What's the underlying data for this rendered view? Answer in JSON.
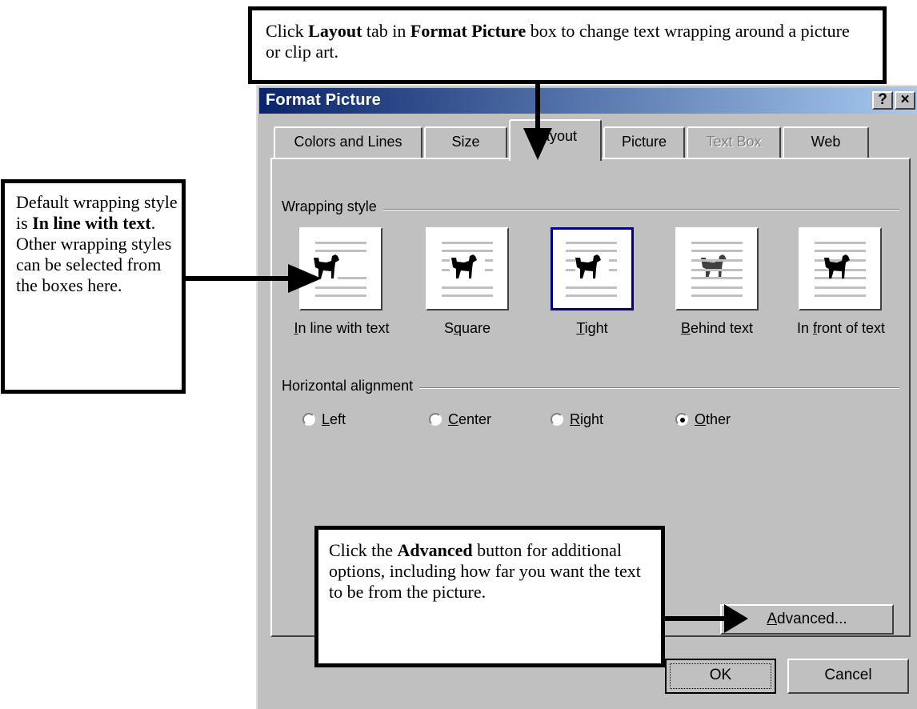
{
  "callouts": {
    "top": {
      "p1": "Click ",
      "b1": "Layout",
      "p2": " tab in ",
      "b2": "Format Picture",
      "p3": " box to change text wrapping around a picture or clip art."
    },
    "left": {
      "p1": "Default wrapping style is ",
      "b1": "In line with text",
      "p2": ".  Other wrapping styles can be selected from the boxes here."
    },
    "bottom": {
      "p1": "Click the ",
      "b1": "Advanced",
      "p2": " button for additional options, including how far you want the text to be from the picture."
    }
  },
  "dialog": {
    "title": "Format Picture",
    "help_label": "?",
    "close_label": "×",
    "tabs": [
      {
        "label": "Colors and Lines",
        "state": "normal"
      },
      {
        "label": "Size",
        "state": "normal"
      },
      {
        "label": "Layout",
        "state": "active"
      },
      {
        "label": "Picture",
        "state": "normal"
      },
      {
        "label": "Text Box",
        "state": "disabled"
      },
      {
        "label": "Web",
        "state": "normal"
      }
    ],
    "wrapping": {
      "label": "Wrapping style",
      "options": [
        {
          "pre": "",
          "u": "I",
          "post": "n line with text",
          "selected": false
        },
        {
          "pre": "S",
          "u": "q",
          "post": "uare",
          "selected": false
        },
        {
          "pre": "",
          "u": "T",
          "post": "ight",
          "selected": true
        },
        {
          "pre": "",
          "u": "B",
          "post": "ehind text",
          "selected": false
        },
        {
          "pre": "In ",
          "u": "f",
          "post": "ront of text",
          "selected": false
        }
      ]
    },
    "alignment": {
      "label": "Horizontal alignment",
      "options": [
        {
          "u": "L",
          "post": "eft",
          "checked": false
        },
        {
          "u": "C",
          "post": "enter",
          "checked": false
        },
        {
          "u": "R",
          "post": "ight",
          "checked": false
        },
        {
          "u": "O",
          "post": "ther",
          "checked": true
        }
      ]
    },
    "advanced": {
      "u": "A",
      "post": "dvanced..."
    },
    "ok_label": "OK",
    "cancel_label": "Cancel"
  },
  "colors": {
    "dialog_bg": "#c0c0c0",
    "title_start": "#0a246a",
    "title_end": "#a6caf0",
    "selected_border": "#000080"
  }
}
